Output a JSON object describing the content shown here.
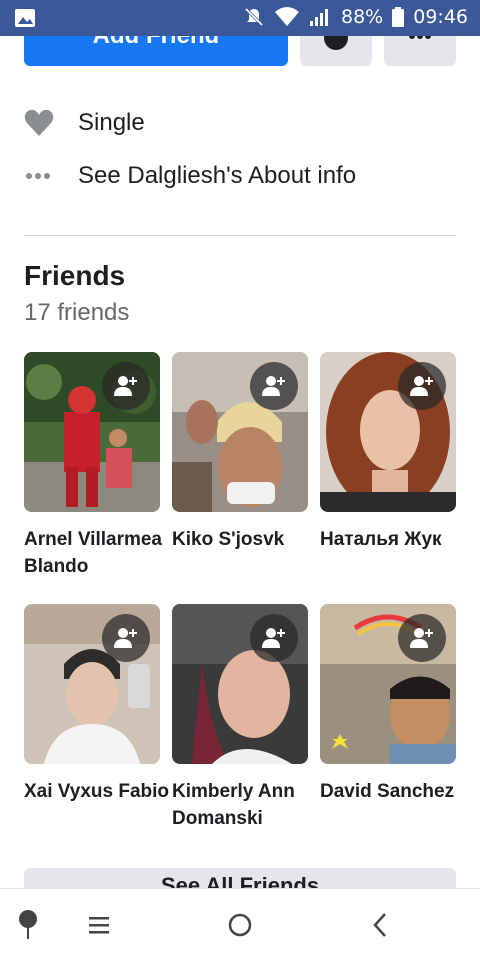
{
  "status_bar": {
    "battery": "88%",
    "time": "09:46"
  },
  "actions": {
    "add_friend_label": "Add Friend"
  },
  "info": {
    "relationship": "Single",
    "about_link": "See Dalgliesh's About info"
  },
  "friends": {
    "title": "Friends",
    "count": "17 friends",
    "items": [
      {
        "name": "Arnel Villarmea Blando"
      },
      {
        "name": "Kiko S'josvk"
      },
      {
        "name": "Наталья Жук"
      },
      {
        "name": "Xai Vyxus Fabio"
      },
      {
        "name": "Kimberly Ann Domanski"
      },
      {
        "name": "David Sanchez"
      }
    ],
    "see_all_label": "See All Friends"
  },
  "nav": {
    "icons": [
      "pin-icon",
      "menu-icon",
      "home-circle-icon",
      "back-icon"
    ]
  }
}
